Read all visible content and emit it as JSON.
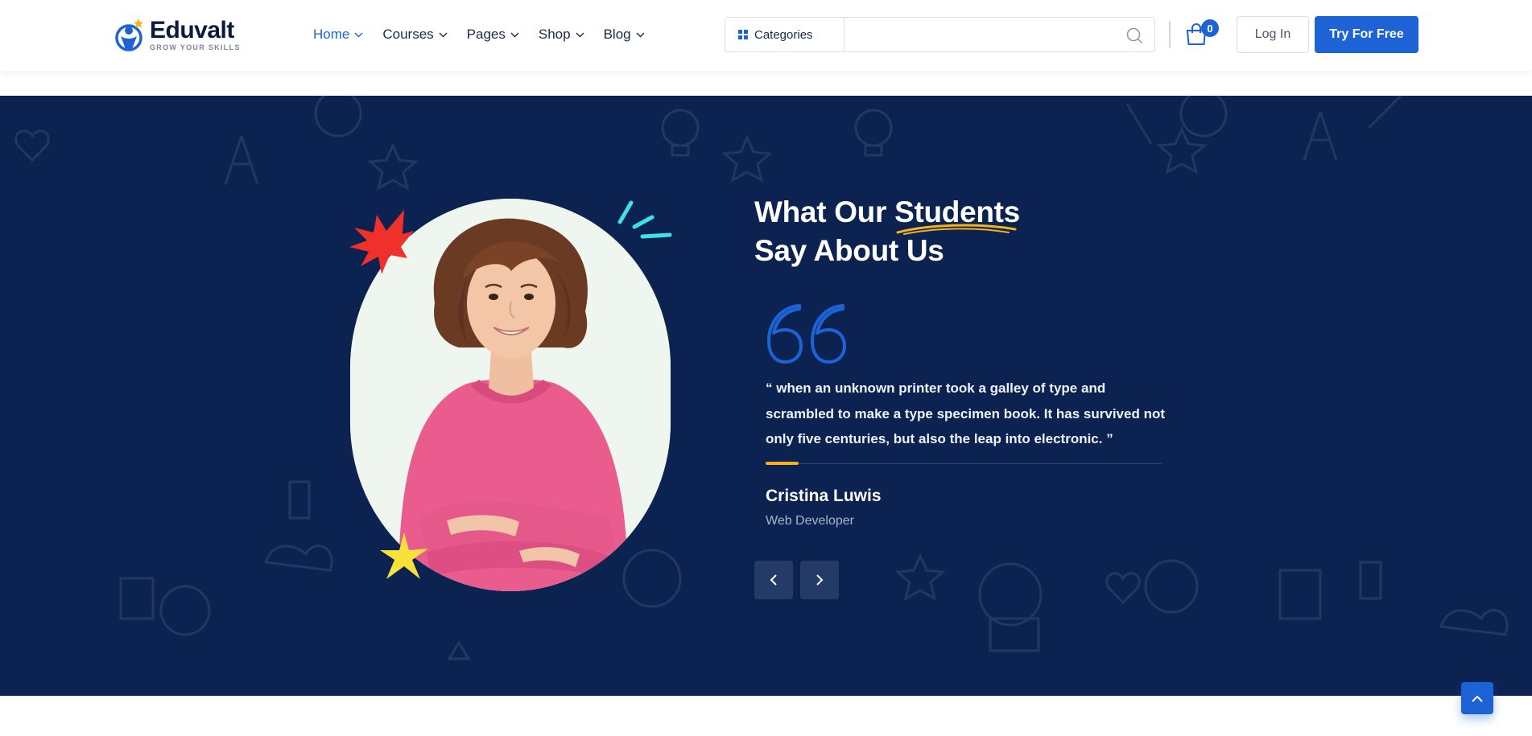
{
  "brand": {
    "name": "Eduvalt",
    "tagline": "GROW YOUR SKILLS",
    "colors": {
      "primary": "#1e63d6",
      "navy": "#0c2352",
      "accent": "#f5b21b",
      "burst": "#f0302b",
      "star": "#f8e13a",
      "spark": "#3fe0e8"
    }
  },
  "nav": {
    "items": [
      {
        "label": "Home",
        "active": true
      },
      {
        "label": "Courses",
        "active": false
      },
      {
        "label": "Pages",
        "active": false
      },
      {
        "label": "Shop",
        "active": false
      },
      {
        "label": "Blog",
        "active": false
      }
    ]
  },
  "search": {
    "categories_label": "Categories",
    "placeholder": ""
  },
  "cart": {
    "count": "0"
  },
  "auth": {
    "login_label": "Log In",
    "try_label": "Try For Free"
  },
  "testimonial": {
    "heading_line1_prefix": "What Our ",
    "heading_highlight": "Students",
    "heading_line2": "Say About Us",
    "quote": "“ when an unknown printer took a galley of type and scrambled to make a type specimen book. It has survived not only five centuries, but also the leap into electronic. ”",
    "author": "Cristina Luwis",
    "role": "Web Developer"
  },
  "icons": {
    "logo": "graduate-logo-icon",
    "nav_caret": "chevron-down-icon",
    "categories": "grid-icon",
    "search": "search-icon",
    "cart": "shopping-bag-icon",
    "prev": "chevron-left-icon",
    "next": "chevron-right-icon",
    "to_top": "chevron-up-icon"
  }
}
